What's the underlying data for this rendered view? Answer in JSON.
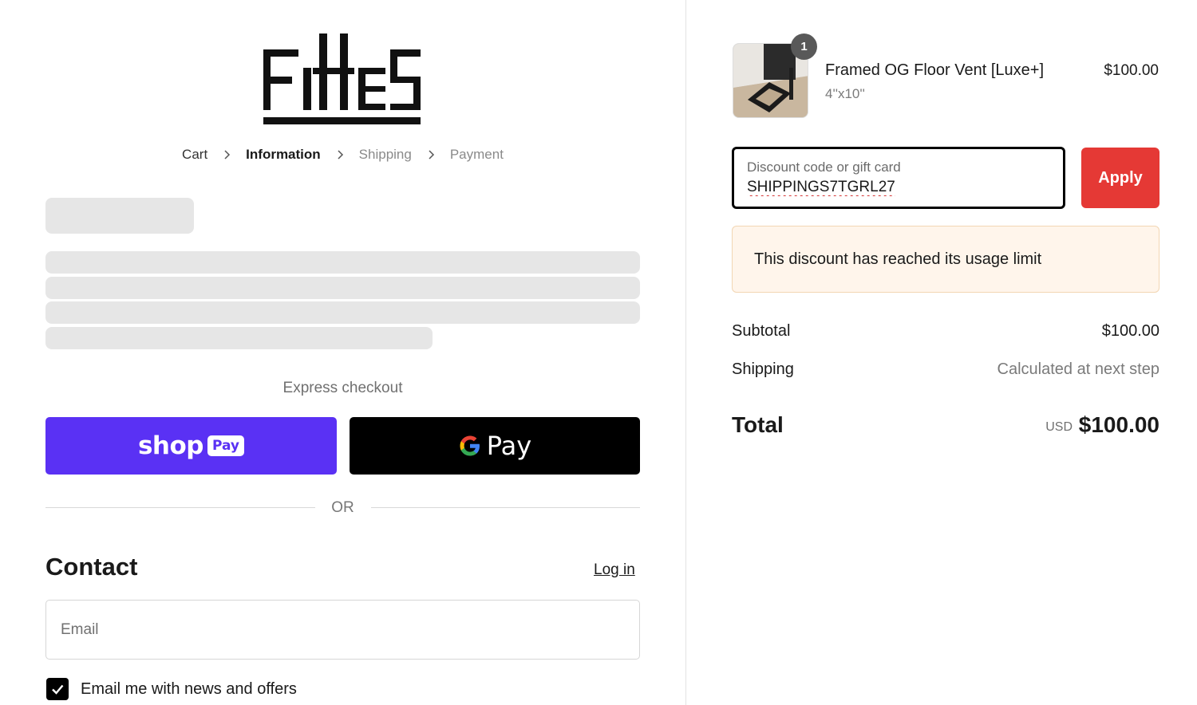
{
  "brand": {
    "name": "Fittes"
  },
  "breadcrumb": [
    "Cart",
    "Information",
    "Shipping",
    "Payment"
  ],
  "express": {
    "label": "Express checkout",
    "shoppay": {
      "word": "shop",
      "badge": "Pay",
      "color": "#5a31f4"
    },
    "gpay": {
      "word": "Pay"
    }
  },
  "or_text": "OR",
  "contact": {
    "heading": "Contact",
    "login": "Log in",
    "email_placeholder": "Email",
    "newsletter_label": "Email me with news and offers",
    "newsletter_checked": true
  },
  "cart_item": {
    "quantity": "1",
    "name": "Framed OG Floor Vent [Luxe+]",
    "variant": "4''x10''",
    "price": "$100.00"
  },
  "discount": {
    "label": "Discount code or gift card",
    "value": "SHIPPINGS7TGRL27",
    "apply": "Apply",
    "error": "This discount has reached its usage limit",
    "accent": "#e53935"
  },
  "summary": {
    "subtotal_label": "Subtotal",
    "subtotal_value": "$100.00",
    "shipping_label": "Shipping",
    "shipping_value": "Calculated at next step",
    "total_label": "Total",
    "currency": "USD",
    "total_value": "$100.00"
  }
}
